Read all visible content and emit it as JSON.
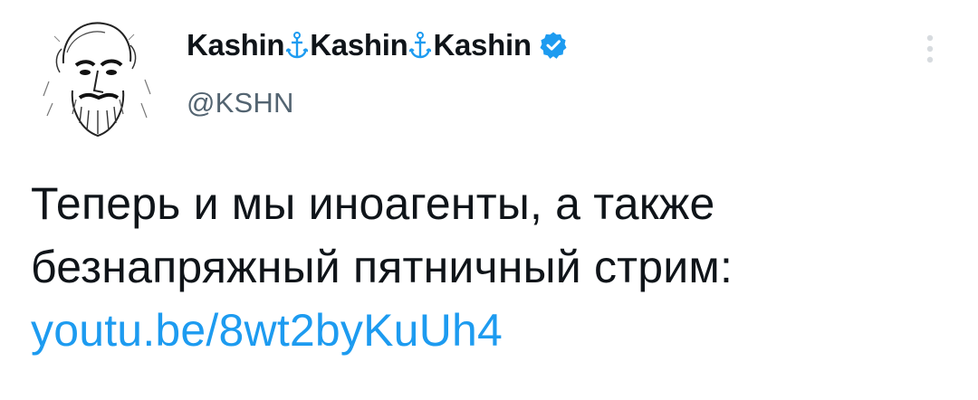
{
  "tweet": {
    "author": {
      "name_parts": [
        "Kashin",
        "Kashin",
        "Kashin"
      ],
      "separator_icon": "anchor-icon",
      "verified_icon": "verified-badge-icon",
      "handle": "@KSHN",
      "avatar": "sketch-portrait-avatar"
    },
    "more_icon": "more-options-icon",
    "text_lines": [
      "Теперь и мы иноагенты, а также",
      "безнапряжный пятничный стрим:"
    ],
    "link": "youtu.be/8wt2byKuUh4"
  },
  "colors": {
    "text": "#0f1419",
    "secondary": "#536471",
    "link": "#1d9bf0",
    "verified": "#1d9bf0",
    "anchor": "#1d9bf0"
  }
}
